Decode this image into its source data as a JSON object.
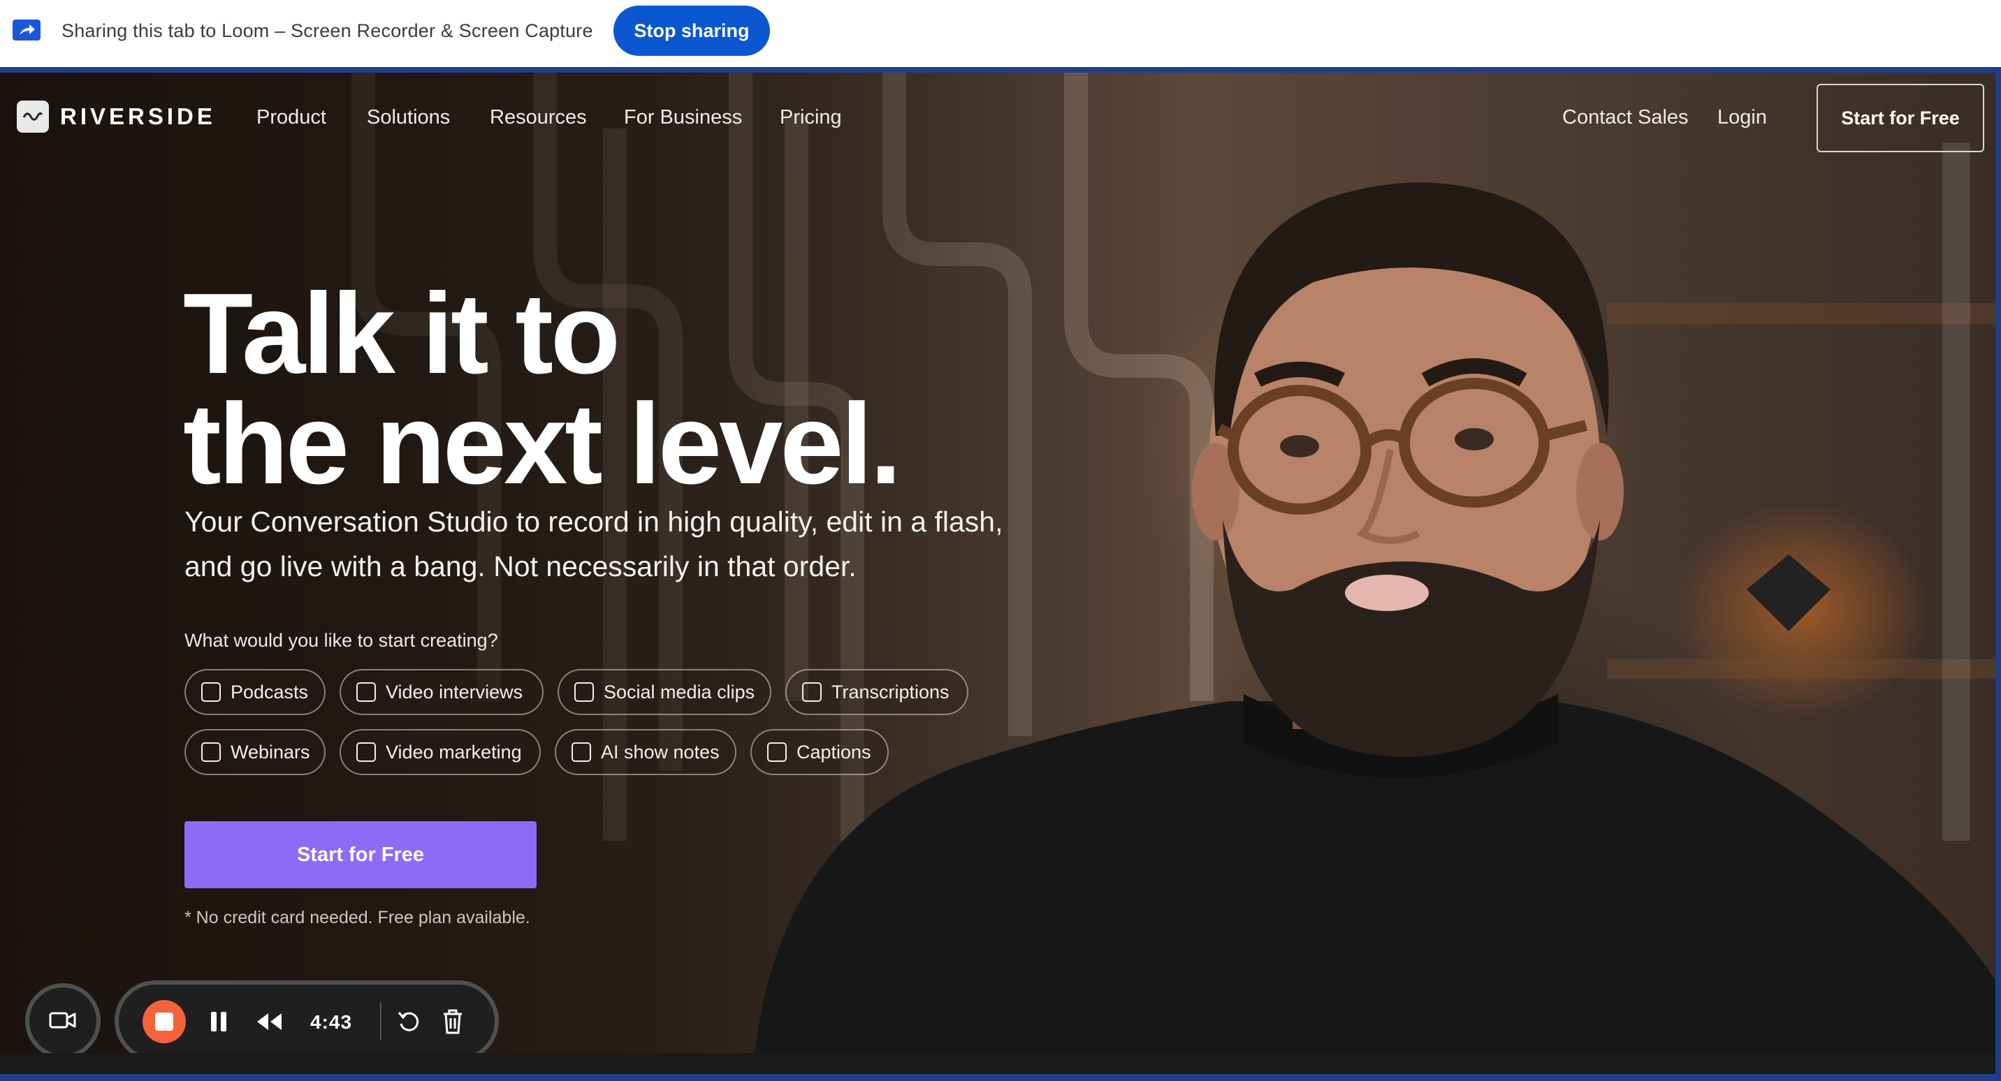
{
  "share_bar": {
    "text": "Sharing this tab to Loom – Screen Recorder & Screen Capture",
    "stop_label": "Stop sharing"
  },
  "nav": {
    "logo_text": "RIVERSIDE",
    "items": [
      "Product",
      "Solutions",
      "Resources",
      "For Business",
      "Pricing"
    ],
    "contact_sales": "Contact Sales",
    "login": "Login",
    "start_free": "Start for Free"
  },
  "hero": {
    "title_line1": "Talk it to",
    "title_line2": "the next level",
    "title_dot": ".",
    "subtitle_line1": "Your Conversation Studio to record in high quality, edit in a flash,",
    "subtitle_line2": "and go live with a bang. Not necessarily in that order.",
    "question": "What would you like to start creating?",
    "options": [
      "Podcasts",
      "Video interviews",
      "Social media clips",
      "Transcriptions",
      "Webinars",
      "Video marketing",
      "AI show notes",
      "Captions"
    ],
    "cta": "Start for Free",
    "note": "* No credit card needed. Free plan available."
  },
  "loom_controls": {
    "timer": "4:43",
    "icons": [
      "camera-icon",
      "stop-record-icon",
      "pause-icon",
      "rewind-icon",
      "restart-icon",
      "trash-icon"
    ]
  },
  "colors": {
    "accent": "#8c6cf7",
    "stop_button": "#0b57d0",
    "record": "#f4623a"
  }
}
